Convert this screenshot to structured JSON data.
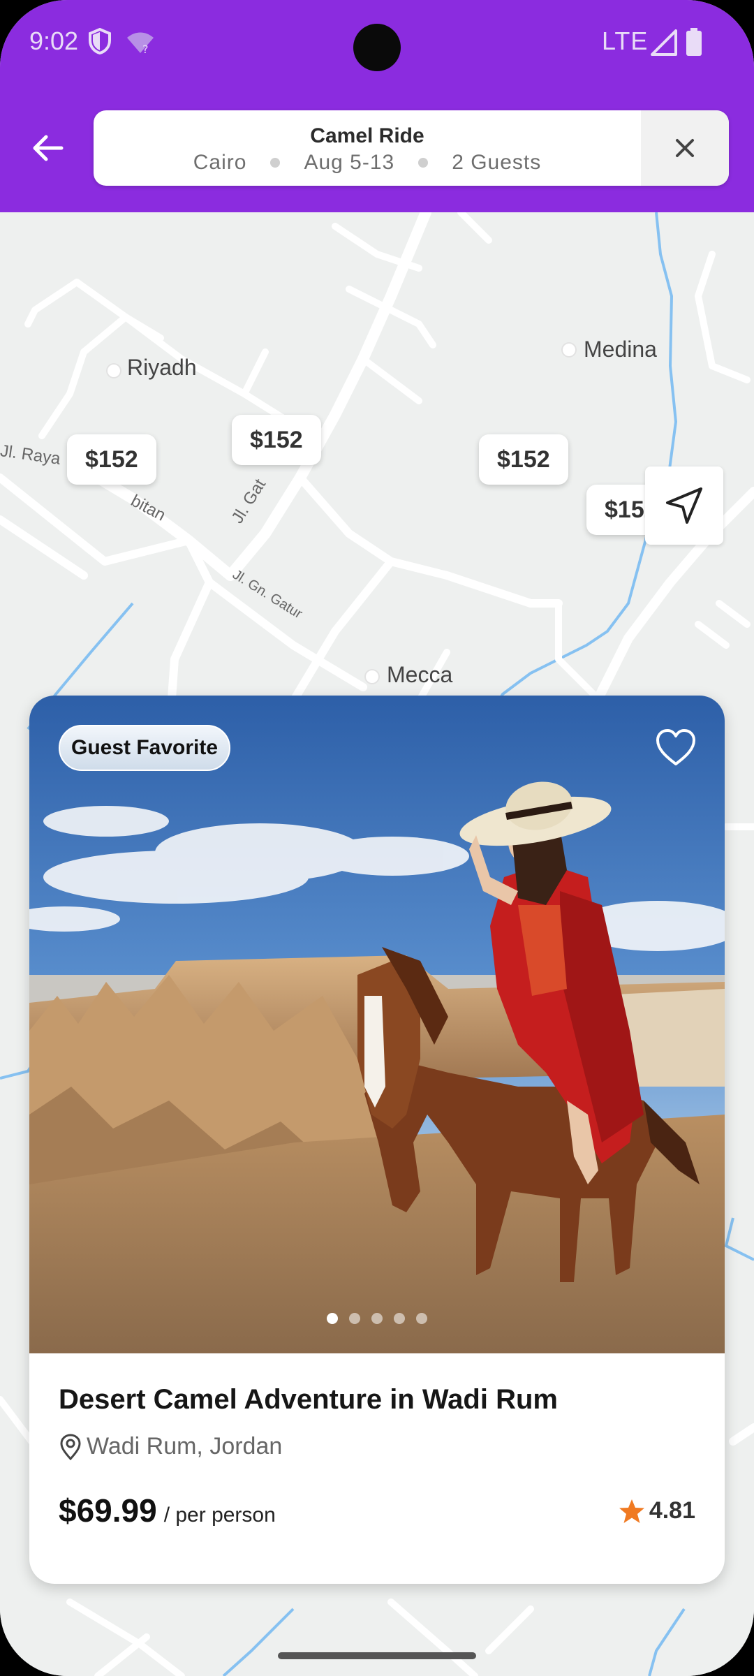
{
  "status_bar": {
    "time": "9:02",
    "network": "LTE"
  },
  "search": {
    "title": "Camel Ride",
    "location": "Cairo",
    "dates": "Aug 5-13",
    "guests": "2 Guests"
  },
  "map": {
    "places": [
      "Riyadh",
      "Medina",
      "Mecca"
    ],
    "streets": [
      "Jl. Raya",
      "bitan",
      "Jl. Gat",
      "Jl. Gn. Gatur"
    ],
    "price_markers": [
      "$152",
      "$152",
      "$152",
      "$152"
    ]
  },
  "listing": {
    "badge": "Guest Favorite",
    "title": "Desert Camel Adventure in Wadi Rum",
    "location": "Wadi Rum, Jordan",
    "price": "$69.99",
    "price_unit": "/ per person",
    "rating": "4.81",
    "photo_count": 5,
    "active_photo": 1,
    "favorited": false
  },
  "colors": {
    "header": "#8b2cdf",
    "rating_star": "#f07a22",
    "map_water": "#7bbdf0"
  },
  "icons": [
    "back-arrow-icon",
    "close-icon",
    "navigate-icon",
    "heart-icon",
    "location-pin-icon",
    "star-icon"
  ]
}
